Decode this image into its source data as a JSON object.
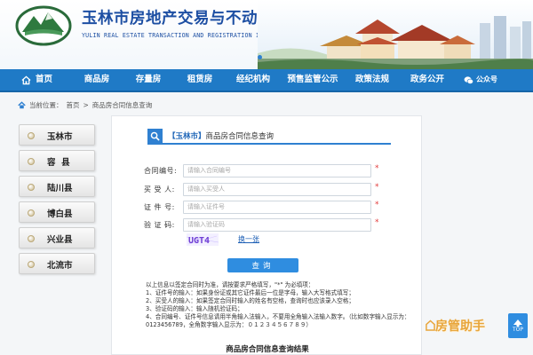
{
  "header": {
    "title": "玉林市房地产交易与不动产登记信息网",
    "subtitle": "YULIN REAL ESTATE TRANSACTION AND REGISTRATION INFORMATION NETWORK"
  },
  "nav": {
    "items": [
      {
        "label": "首页",
        "icon": "home-icon"
      },
      {
        "label": "商品房"
      },
      {
        "label": "存量房"
      },
      {
        "label": "租赁房"
      },
      {
        "label": "经纪机构"
      },
      {
        "label": "预售监管公示"
      },
      {
        "label": "政策法规"
      },
      {
        "label": "政务公开"
      },
      {
        "label": "公众号",
        "icon": "wechat-icon"
      }
    ]
  },
  "breadcrumb": {
    "prefix": "当前位置：",
    "home": "首页",
    "separator": ">",
    "current": "商品房合同信息查询"
  },
  "sidebar": {
    "counties": [
      "玉林市",
      "容  县",
      "陆川县",
      "博白县",
      "兴业县",
      "北流市"
    ]
  },
  "panel": {
    "city": "【玉林市】",
    "title": "商品房合同信息查询",
    "form": {
      "contract_label": "合同编号:",
      "contract_placeholder": "请输入合同编号",
      "buyer_label": "买 受 人:",
      "buyer_placeholder": "请输入买受人",
      "cert_label": "证 件 号:",
      "cert_placeholder": "请输入证件号",
      "captcha_label": "验 证 码:",
      "captcha_placeholder": "请输入验证码",
      "required_mark": "*",
      "captcha_text": "UGT4",
      "refresh_label": "换一张"
    },
    "query_button": "查询",
    "notes": [
      "以上信息以签定合同时为准，请按要求严格填写，\"*\" 为必填项：",
      "1、证件号的输入：如果身份证或其它证件最后一位是字母，输入大写格式填写；",
      "2、买受人的输入：如果签定合同时输入的姓名有空格，查询时也应该录入空格；",
      "3、验证码的输入：输入随机验证码；",
      "4、合同编号、证件号信息请用半角输入法输入，不要用全角输入法输入数字。（比如数字输入显示为：0123456789，全角数字输入显示为：０１２３４５６７８９）"
    ],
    "result_title": "商品房合同信息查询结果"
  },
  "watermark": "房管助手",
  "top_button": "TOP",
  "colors": {
    "nav_bg": "#1f7ac6",
    "accent": "#2f80d1",
    "title_blue": "#1d4fa3",
    "required_red": "#e23b3b",
    "watermark_orange": "#e8a53a"
  }
}
